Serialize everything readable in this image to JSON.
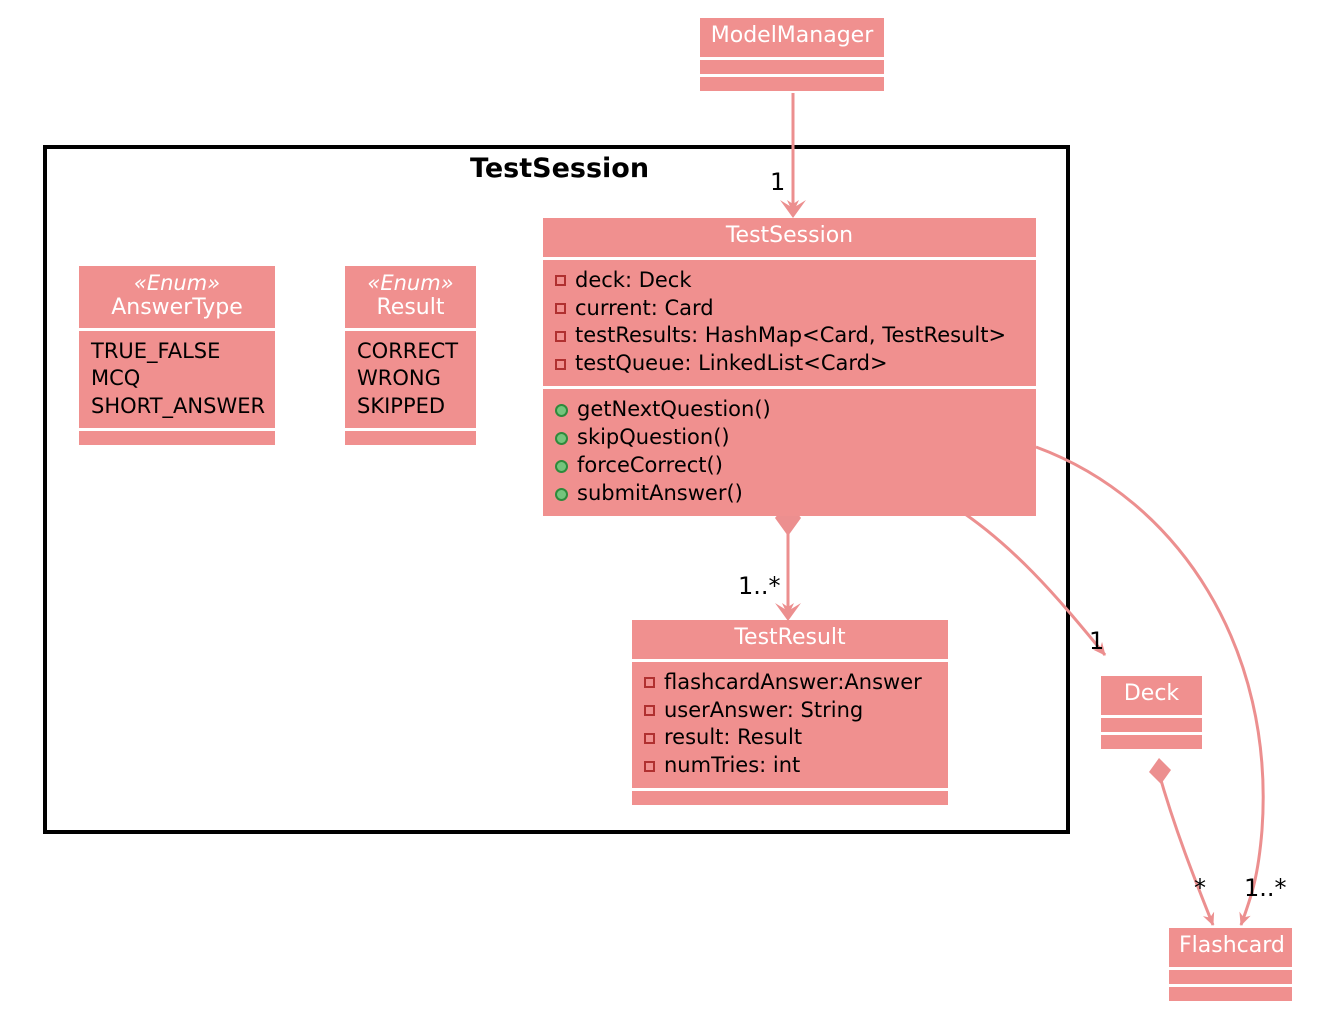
{
  "diagram": {
    "type": "uml-class-diagram",
    "background": "#ffffff",
    "class_fill": "#F0908F",
    "class_title_color": "#ffffff",
    "link_color": "#EC8F8F",
    "package_border": "#000000"
  },
  "package": {
    "title": "TestSession"
  },
  "classes": {
    "model_manager": {
      "name": "ModelManager",
      "attributes": [],
      "methods": []
    },
    "answer_type": {
      "stereotype": "«Enum»",
      "name": "AnswerType",
      "literals": [
        "TRUE_FALSE",
        "MCQ",
        "SHORT_ANSWER"
      ]
    },
    "result_enum": {
      "stereotype": "«Enum»",
      "name": "Result",
      "literals": [
        "CORRECT",
        "WRONG",
        "SKIPPED"
      ]
    },
    "test_session": {
      "name": "TestSession",
      "attributes": [
        {
          "visibility": "private",
          "text": "deck: Deck"
        },
        {
          "visibility": "private",
          "text": "current: Card"
        },
        {
          "visibility": "private",
          "text": "testResults: HashMap<Card, TestResult>"
        },
        {
          "visibility": "private",
          "text": "testQueue: LinkedList<Card>"
        }
      ],
      "methods": [
        {
          "visibility": "public",
          "text": "getNextQuestion()"
        },
        {
          "visibility": "public",
          "text": "skipQuestion()"
        },
        {
          "visibility": "public",
          "text": "forceCorrect()"
        },
        {
          "visibility": "public",
          "text": "submitAnswer()"
        }
      ]
    },
    "test_result": {
      "name": "TestResult",
      "attributes": [
        {
          "visibility": "private",
          "text": "flashcardAnswer:Answer"
        },
        {
          "visibility": "private",
          "text": "userAnswer: String"
        },
        {
          "visibility": "private",
          "text": "result: Result"
        },
        {
          "visibility": "private",
          "text": "numTries: int"
        }
      ],
      "methods": []
    },
    "deck": {
      "name": "Deck",
      "attributes": [],
      "methods": []
    },
    "flashcard": {
      "name": "Flashcard",
      "attributes": [],
      "methods": []
    }
  },
  "relationships": [
    {
      "id": "modelmanager-testsession",
      "from": "ModelManager",
      "to": "TestSession",
      "kind": "association",
      "multiplicity": "1"
    },
    {
      "id": "testsession-testresult",
      "from": "TestSession",
      "to": "TestResult",
      "kind": "composition",
      "multiplicity": "1..*"
    },
    {
      "id": "testsession-deck",
      "from": "TestSession",
      "to": "Deck",
      "kind": "association",
      "multiplicity": "1"
    },
    {
      "id": "deck-flashcard",
      "from": "Deck",
      "to": "Flashcard",
      "kind": "composition",
      "multiplicity": "*"
    },
    {
      "id": "testsession-flashcard",
      "from": "TestSession",
      "to": "Flashcard",
      "kind": "association",
      "multiplicity": "1..*"
    }
  ]
}
